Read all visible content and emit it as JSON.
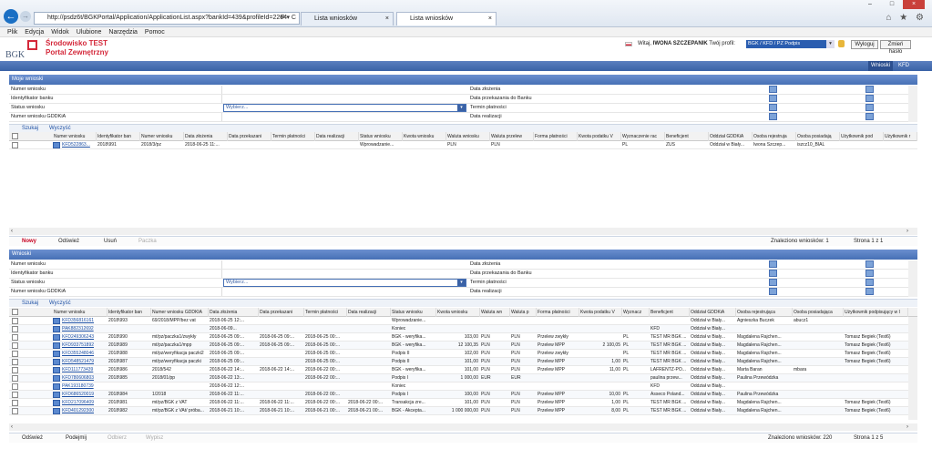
{
  "browser": {
    "back": "←",
    "forward": "→",
    "address": "http://psdz6t/BGKPortal/Application/ApplicationList.aspx?bankId=439&profileId=2264",
    "address_tools": "P ▾ C",
    "tabs": [
      {
        "label": "Lista wniosków"
      },
      {
        "label": "Lista wniosków"
      }
    ],
    "tab_close": "×",
    "window_buttons": [
      "–",
      "□",
      "×"
    ],
    "toolbar_icons": "⌂ ★ ⚙"
  },
  "menu": [
    "Plik",
    "Edycja",
    "Widok",
    "Ulubione",
    "Narzędzia",
    "Pomoc"
  ],
  "header": {
    "logo_text": "BGK",
    "brand_line1": "Środowisko TEST",
    "brand_line2": "Portal Zewnętrzny",
    "welcome_prefix": "Witaj,",
    "user_name": "IWONA SZCZEPANIK",
    "profile_label": "Twój profil:",
    "profile_value": "BGK / KFD / PZ Podpis",
    "logout": "Wyloguj",
    "change_password": "Zmień hasło"
  },
  "nav": {
    "wnioski": "Wnioski",
    "kfd": "KFD"
  },
  "panel1": {
    "title": "Moje wnioski",
    "filters": {
      "left": [
        "Numer wniosku",
        "Identyfikator banku",
        "Status wniosku",
        "Numer wniosku GDDKiA"
      ],
      "right": [
        "Data złożenia",
        "Data przekazania do Banku",
        "Termin płatności",
        "Data realizacji"
      ],
      "select_placeholder": "Wybierz..."
    },
    "search": "Szukaj",
    "clear": "Wyczyść",
    "columns": [
      "Numer wniosku",
      "Identyfikator ban",
      "Numer wniosku",
      "Data złożenia",
      "Data przekazani",
      "Termin płatności",
      "Data realizacji",
      "Status wniosku",
      "Kwota wniosku",
      "Waluta wniosku",
      "Waluta przelew",
      "Forma płatności",
      "Kwota podatku V",
      "Wyznaczenie rac",
      "Beneficjent",
      "Oddział GDDKiA",
      "Osoba rejestruja",
      "Osoba posiadają",
      "Użytkownik pod",
      "Użytkownik r"
    ],
    "rows": [
      [
        "KFD522863...",
        "2018\\991",
        "2018/3/pz",
        "2018-06-25 11:...",
        "",
        "",
        "",
        "Wprowadzanie...",
        "",
        "PLN",
        "PLN",
        "",
        "",
        "PL",
        "ZUS",
        "Oddział w Biały...",
        "Iwona Szczep...",
        "iszcz10_BIAL",
        "",
        ""
      ]
    ],
    "toolbar": {
      "new": "Nowy",
      "refresh": "Odśwież",
      "delete": "Usuń",
      "print": "Paczka"
    },
    "found": "Znaleziono wniosków: 1",
    "page": "Strona 1 z 1"
  },
  "panel2": {
    "title": "Wnioski",
    "filters": {
      "left": [
        "Numer wniosku",
        "Identyfikator banku",
        "Status wniosku",
        "Numer wniosku GDDKiA"
      ],
      "right": [
        "Data złożenia",
        "Data przekazania do Banku",
        "Termin płatności",
        "Data realizacji"
      ],
      "select_placeholder": "Wybierz..."
    },
    "search": "Szukaj",
    "clear": "Wyczyść",
    "columns": [
      "Numer wniosku",
      "Identyfikator ban",
      "Numer wniosku GDDKIA",
      "Data złożenia",
      "Data przekazani",
      "Termin płatności",
      "Data realizacji",
      "Status wniosku",
      "Kwota wniosku",
      "Waluta wn",
      "Waluta p",
      "Forma płatności",
      "Kwota podatku V",
      "Wyznacz",
      "Beneficjent",
      "Oddział GDDKiA",
      "Osoba rejestrująca",
      "Osoba posiadająca",
      "Użytkownik podpisujący w I"
    ],
    "rows": [
      [
        "KFD356816161",
        "2018\\993",
        "69/2018/MPP/bez vat",
        "2018-06-25 12:...",
        "",
        "",
        "",
        "Wprowadzanie...",
        "",
        "",
        "",
        "",
        "",
        "",
        "",
        "Oddział w Biały...",
        "Agnieszka Buczek",
        "abucz1",
        ""
      ],
      [
        "PAK882312692",
        "",
        "",
        "2018-06-09...",
        "",
        "",
        "",
        "Koniec",
        "",
        "",
        "",
        "",
        "",
        "",
        "KFD",
        "Oddział w Biały...",
        "",
        "",
        ""
      ],
      [
        "KFD249306243",
        "2018\\990",
        "mt/pz/paczka1/zwykły",
        "2018-06-25 09:...",
        "2018-06-25 09:...",
        "2018-06-25 00:...",
        "",
        "BGK - weryfika...",
        "103,00",
        "PLN",
        "PLN",
        "Przelew zwykły",
        "",
        "PL",
        "TEST MR BGK ...",
        "Oddział w Biały...",
        "Magdalena Rajchen...",
        "",
        "Tomasz Begiek (Test6)"
      ],
      [
        "KFD933751892",
        "2018\\989",
        "mt/pz/paczka1/mpp",
        "2018-06-25 09:...",
        "2018-06-25 09:...",
        "2018-06-25 00:...",
        "",
        "BGK - weryfika...",
        "12 100,35",
        "PLN",
        "PLN",
        "Przelew MPP",
        "2 100,05",
        "PL",
        "TEST MR BGK ...",
        "Oddział w Biały...",
        "Magdalena Rajchen...",
        "",
        "Tomasz Begiek (Test6)"
      ],
      [
        "KFD355248046",
        "2018\\988",
        "mt/pz/weryfikacja paczki2",
        "2018-06-25 09:...",
        "",
        "2018-06-25 00:...",
        "",
        "Podpis II",
        "102,00",
        "PLN",
        "PLN",
        "Przelew zwykły",
        "",
        "PL",
        "TEST MR BGK ...",
        "Oddział w Biały...",
        "Magdalena Rajchen...",
        "",
        "Tomasz Begiek (Test6)"
      ],
      [
        "KFD548521479",
        "2018\\987",
        "mt/pz/weryfikacja paczki",
        "2018-06-25 09:...",
        "",
        "2018-06-25 00:...",
        "",
        "Podpis II",
        "101,00",
        "PLN",
        "PLN",
        "Przelew MPP",
        "1,00",
        "PL",
        "TEST MR BGK ...",
        "Oddział w Biały...",
        "Magdalena Rajchen...",
        "",
        "Tomasz Begiek (Test6)"
      ],
      [
        "KFD111773439",
        "2018\\986",
        "2018/542",
        "2018-06-22 14:...",
        "2018-06-22 14:...",
        "2018-06-22 00:...",
        "",
        "BGK - weryfika...",
        "101,00",
        "PLN",
        "PLN",
        "Przelew MPP",
        "11,00",
        "PL",
        "LAFRENTZ-PO...",
        "Oddział w Biały...",
        "Marta Baran",
        "mbara",
        ""
      ],
      [
        "KFD780606803",
        "2018\\985",
        "2018/01/pp",
        "2018-06-22 13:...",
        "",
        "2018-06-22 00:...",
        "",
        "Podpis I",
        "1 000,00",
        "EUR",
        "EUR",
        "",
        "",
        "",
        "paulina przew...",
        "Oddział w Biały...",
        "Paulina Przewódzka",
        "",
        ""
      ],
      [
        "PAK193180739",
        "",
        "",
        "2018-06-22 12:...",
        "",
        "",
        "",
        "Koniec",
        "",
        "",
        "",
        "",
        "",
        "",
        "KFD",
        "Oddział w Biały...",
        "",
        "",
        ""
      ],
      [
        "KFD686520019",
        "2018\\984",
        "1/2018",
        "2018-06-22 11:...",
        "",
        "2018-06-22 00:...",
        "",
        "Podpis I",
        "100,00",
        "PLN",
        "PLN",
        "Przelew MPP",
        "10,00",
        "PL",
        "Asseco Poland...",
        "Oddział w Biały...",
        "Paulina Przewódzka",
        "",
        ""
      ],
      [
        "KFD217096409",
        "2018\\981",
        "mt/pz/BGK z VAT",
        "2018-06-22 11:...",
        "2018-06-22 11:...",
        "2018-06-22 00:...",
        "2018-06-22 00:...",
        "Transakcja zre...",
        "101,00",
        "PLN",
        "PLN",
        "Przelew MPP",
        "1,00",
        "PL",
        "TEST MR BGK ...",
        "Oddział w Biały...",
        "Magdalena Rajchen...",
        "",
        "Tomasz Begiek (Test6)"
      ],
      [
        "KFD401292300",
        "2018\\982",
        "mt/pz/BGK z VAt/ próba...",
        "2018-06-21 10:...",
        "2018-06-21 10:...",
        "2018-06-21 00:...",
        "2018-06-21 00:...",
        "BGK - Akcepta...",
        "1 000 000,00",
        "PLN",
        "PLN",
        "Przelew MPP",
        "8,00",
        "PL",
        "TEST MR BGK ...",
        "Oddział w Biały...",
        "Magdalena Rajchen...",
        "",
        "Tomasz Begiek (Test6)"
      ]
    ],
    "toolbar": {
      "refresh": "Odśwież",
      "up": "Podejmij",
      "reject": "Odbierz",
      "print": "Wypisz"
    },
    "found": "Znaleziono wniosków: 220",
    "page": "Strona 1 z 5"
  }
}
